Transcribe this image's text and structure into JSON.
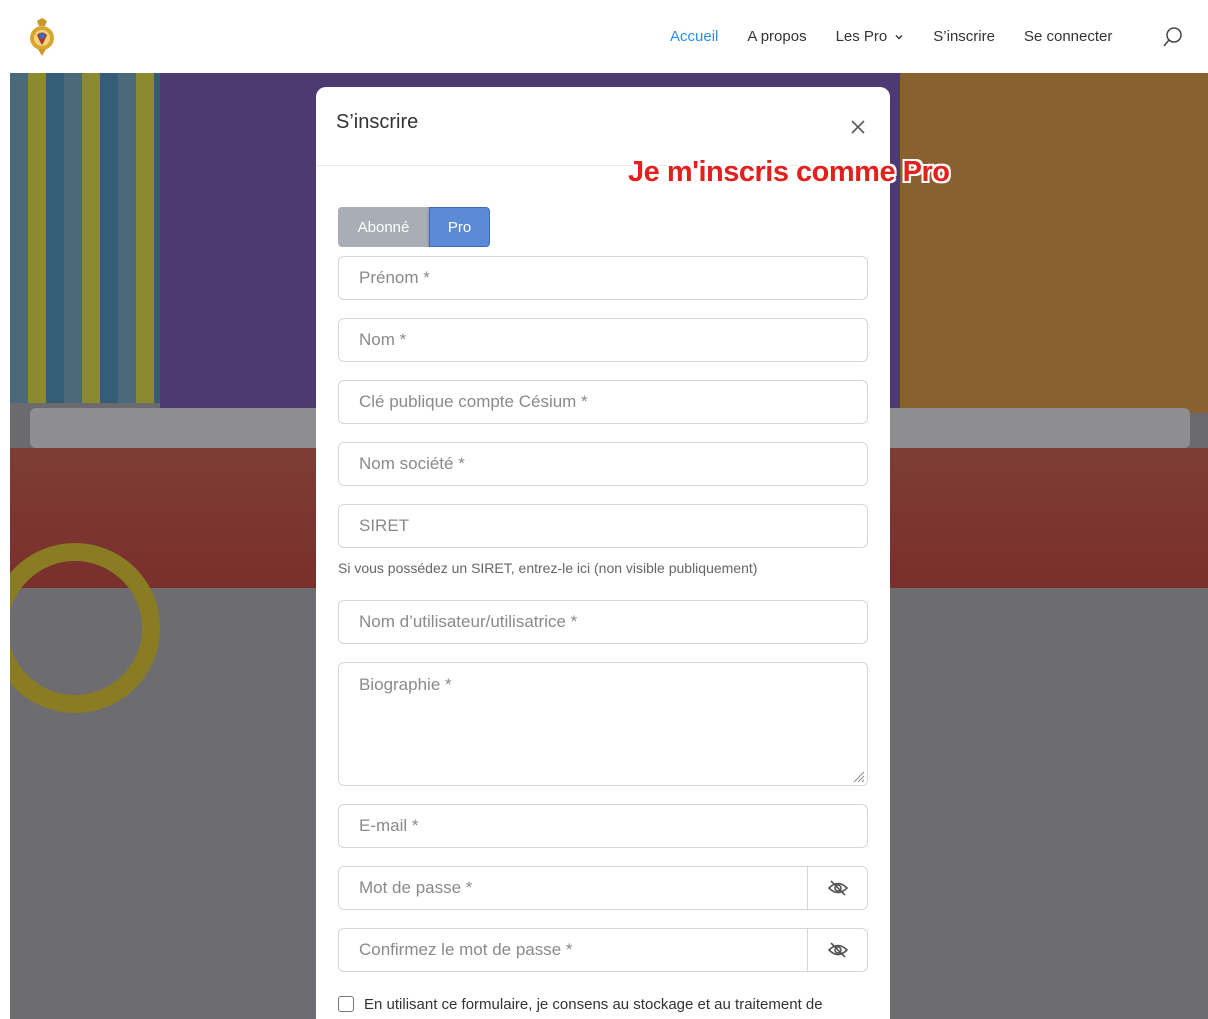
{
  "header": {
    "logo_icon": "medal-crest-icon",
    "nav": [
      {
        "label": "Accueil",
        "active": true
      },
      {
        "label": "A propos",
        "active": false
      },
      {
        "label": "Les Pro",
        "active": false,
        "has_dropdown": true
      },
      {
        "label": "S’inscrire",
        "active": false
      },
      {
        "label": "Se connecter",
        "active": false
      }
    ],
    "search_icon": "search-icon"
  },
  "modal": {
    "title": "S’inscrire",
    "close_icon": "close-icon",
    "role_toggle": {
      "options": [
        "Abonné",
        "Pro"
      ],
      "selected": "Pro"
    },
    "fields": {
      "prenom": "Prénom *",
      "nom": "Nom *",
      "cle": "Clé publique compte Césium *",
      "societe": "Nom société *",
      "siret": "SIRET",
      "siret_help": "Si vous possédez un SIRET, entrez-le ici (non visible publiquement)",
      "username": "Nom d’utilisateur/utilisatrice *",
      "bio": "Biographie *",
      "email": "E-mail *",
      "password": "Mot de passe *",
      "confirm": "Confirmez le mot de passe *"
    },
    "consent_text": "En utilisant ce formulaire, je consens au stockage et au traitement de"
  },
  "annotation": {
    "text": "Je m'inscris comme Pro",
    "color": "#e2211c"
  },
  "colors": {
    "accent": "#2e8ce6",
    "toggle_off": "#a8adb6",
    "toggle_on": "#5b8ad6"
  }
}
